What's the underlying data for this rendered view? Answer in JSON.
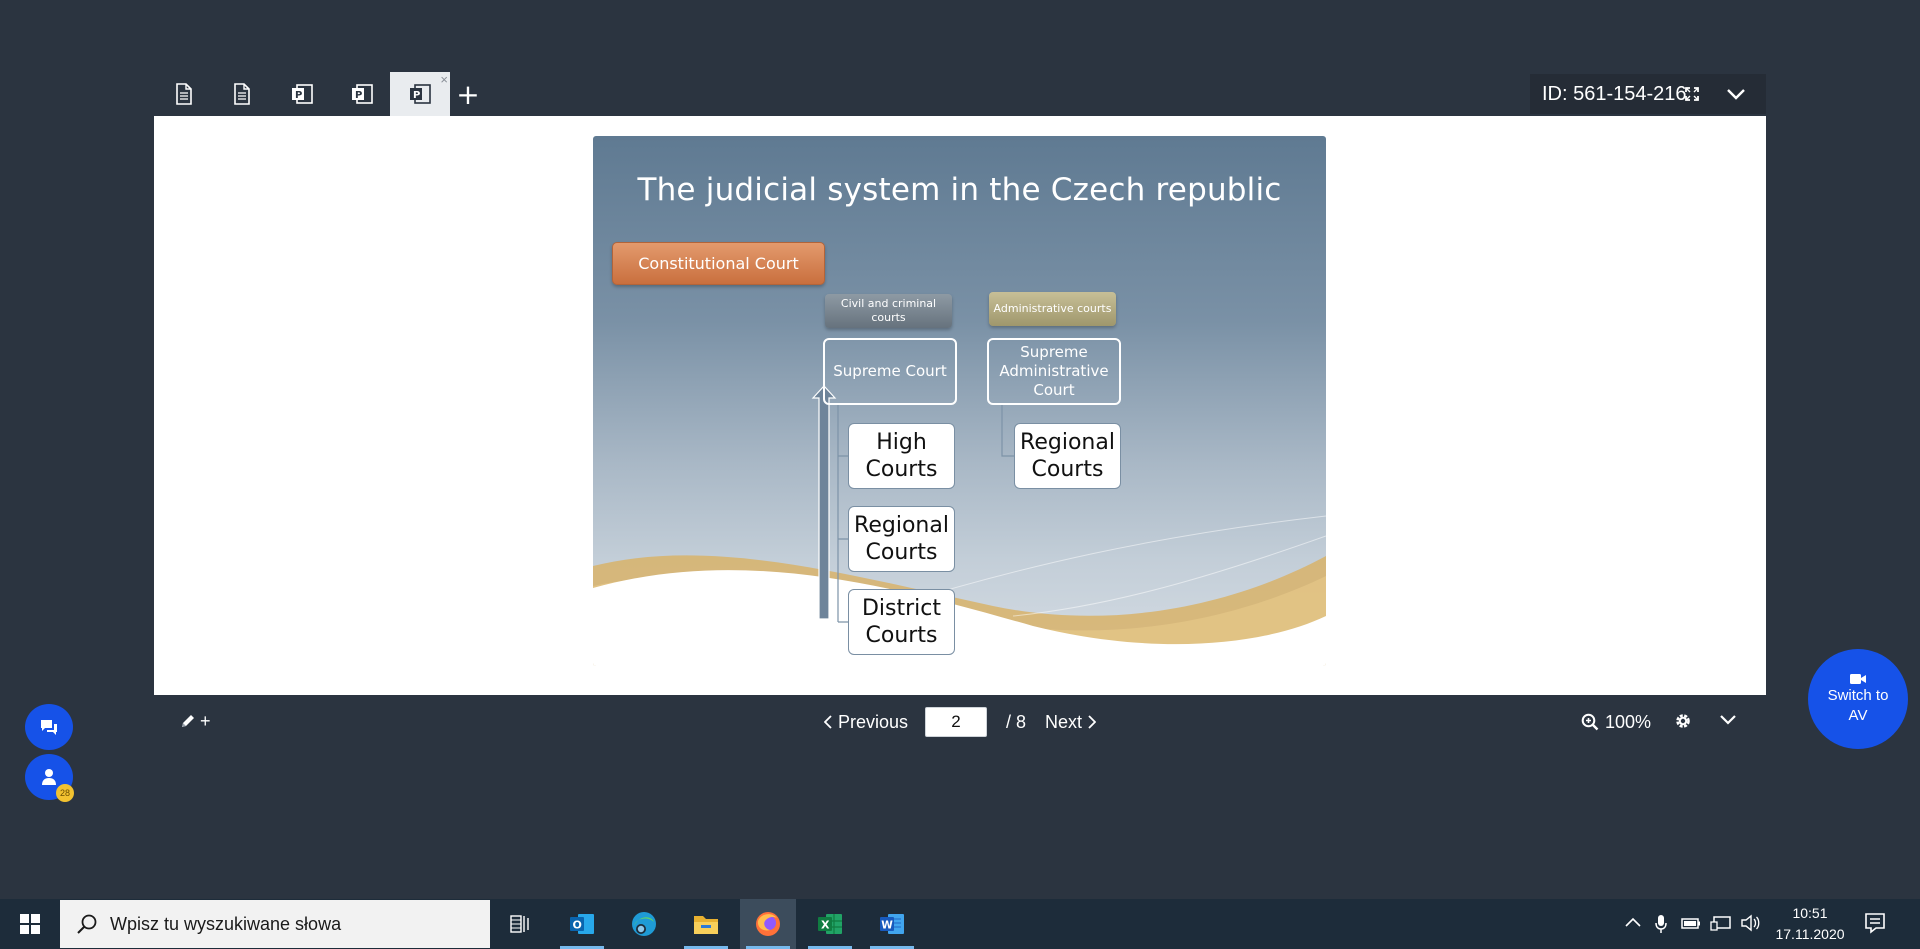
{
  "viewer": {
    "session_id": "ID: 561-154-216",
    "tabs": [
      {
        "type": "document"
      },
      {
        "type": "document"
      },
      {
        "type": "presentation"
      },
      {
        "type": "presentation"
      },
      {
        "type": "presentation",
        "active": true,
        "close": "×"
      }
    ],
    "add_tab": "+"
  },
  "slide": {
    "title": "The judicial system in the Czech republic",
    "constitutional_court": "Constitutional Court",
    "civil_header": "Civil and criminal courts",
    "admin_header": "Administrative courts",
    "supreme_court": "Supreme Court",
    "supreme_admin_court": "Supreme Administrative Court",
    "civil_courts": [
      "High Courts",
      "Regional Courts",
      "District Courts"
    ],
    "admin_courts": [
      "Regional Courts"
    ]
  },
  "toolbar": {
    "annotate_plus": "+",
    "previous": "Previous",
    "page_current": "2",
    "page_total": "/ 8",
    "next": "Next",
    "zoom": "100%"
  },
  "side": {
    "participants_count": "28",
    "switch_av": "Switch to AV"
  },
  "taskbar": {
    "search_placeholder": "Wpisz tu wyszukiwane słowa",
    "time": "10:51",
    "date": "17.11.2020",
    "apps": [
      "task-view",
      "outlook",
      "edge",
      "file-explorer",
      "firefox",
      "excel",
      "word"
    ]
  },
  "colors": {
    "background": "#2b3440",
    "accent_blue": "#1652e8",
    "constitutional_court": "#d4804f",
    "badge": "#f2c230"
  }
}
